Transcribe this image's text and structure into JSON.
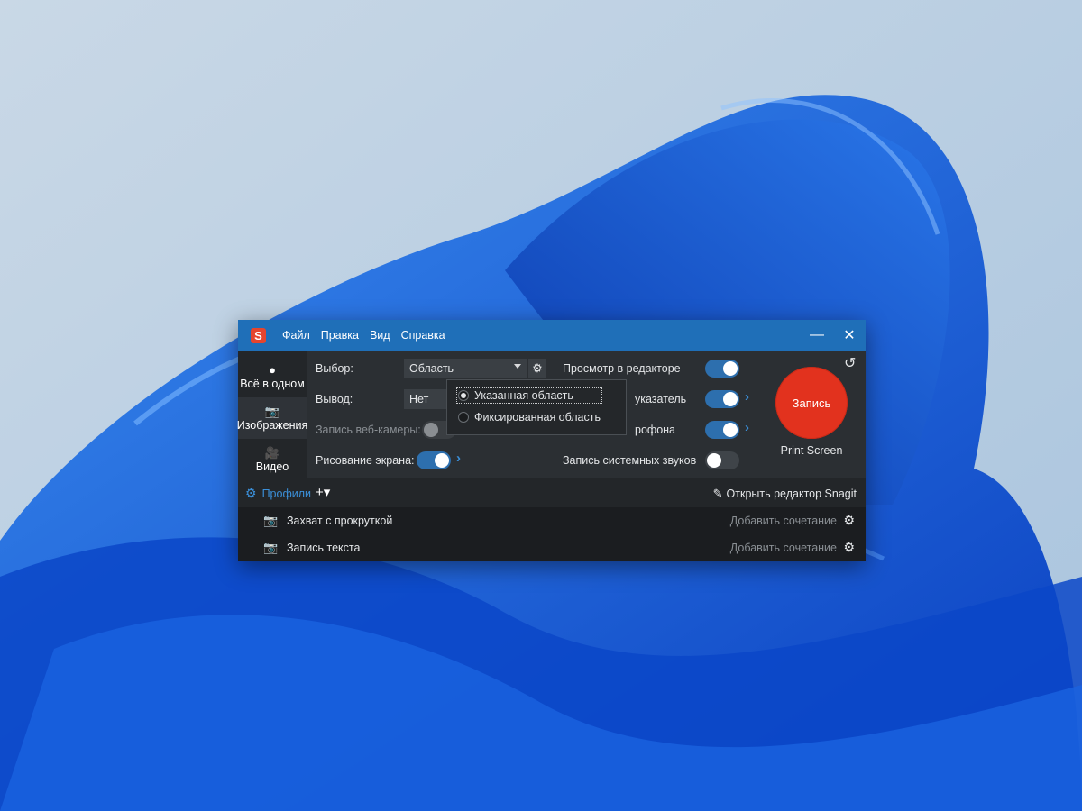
{
  "title_bar": {
    "logo": "S",
    "menu": [
      "Файл",
      "Правка",
      "Вид",
      "Справка"
    ],
    "minimize_icon": "—",
    "close_icon": "✕"
  },
  "sidebar": {
    "modes": [
      {
        "icon": "●",
        "label": "Всё в одном"
      },
      {
        "icon": "📷",
        "label": "Изображения"
      },
      {
        "icon": "🎥",
        "label": "Видео"
      }
    ]
  },
  "settings": {
    "selection_label": "Выбор:",
    "selection_value": "Область",
    "output_label": "Вывод:",
    "output_value": "Нет",
    "webcam_label": "Запись веб-камеры:",
    "draw_label": "Рисование экрана:",
    "preview_label": "Просмотр в редакторе",
    "cursor_label": "указатель",
    "mic_label": "рофона",
    "system_audio_label": "Запись системных звуков"
  },
  "toggles": {
    "webcam": false,
    "draw": true,
    "preview": true,
    "cursor": true,
    "mic": true,
    "system_audio": false
  },
  "record": {
    "label": "Запись",
    "shortcut": "Print Screen"
  },
  "dropdown": {
    "options": [
      "Указанная область",
      "Фиксированная область"
    ],
    "selected_index": 0
  },
  "profiles_bar": {
    "profiles_label": "Профили",
    "add_label": "+▾",
    "open_editor_label": "Открыть редактор Snagit"
  },
  "profile_rows": [
    {
      "name": "Захват с прокруткой",
      "add_shortcut": "Добавить сочетание"
    },
    {
      "name": "Запись текста",
      "add_shortcut": "Добавить сочетание"
    }
  ],
  "colors": {
    "accent": "#1f6fb8",
    "record": "#e2321e"
  }
}
